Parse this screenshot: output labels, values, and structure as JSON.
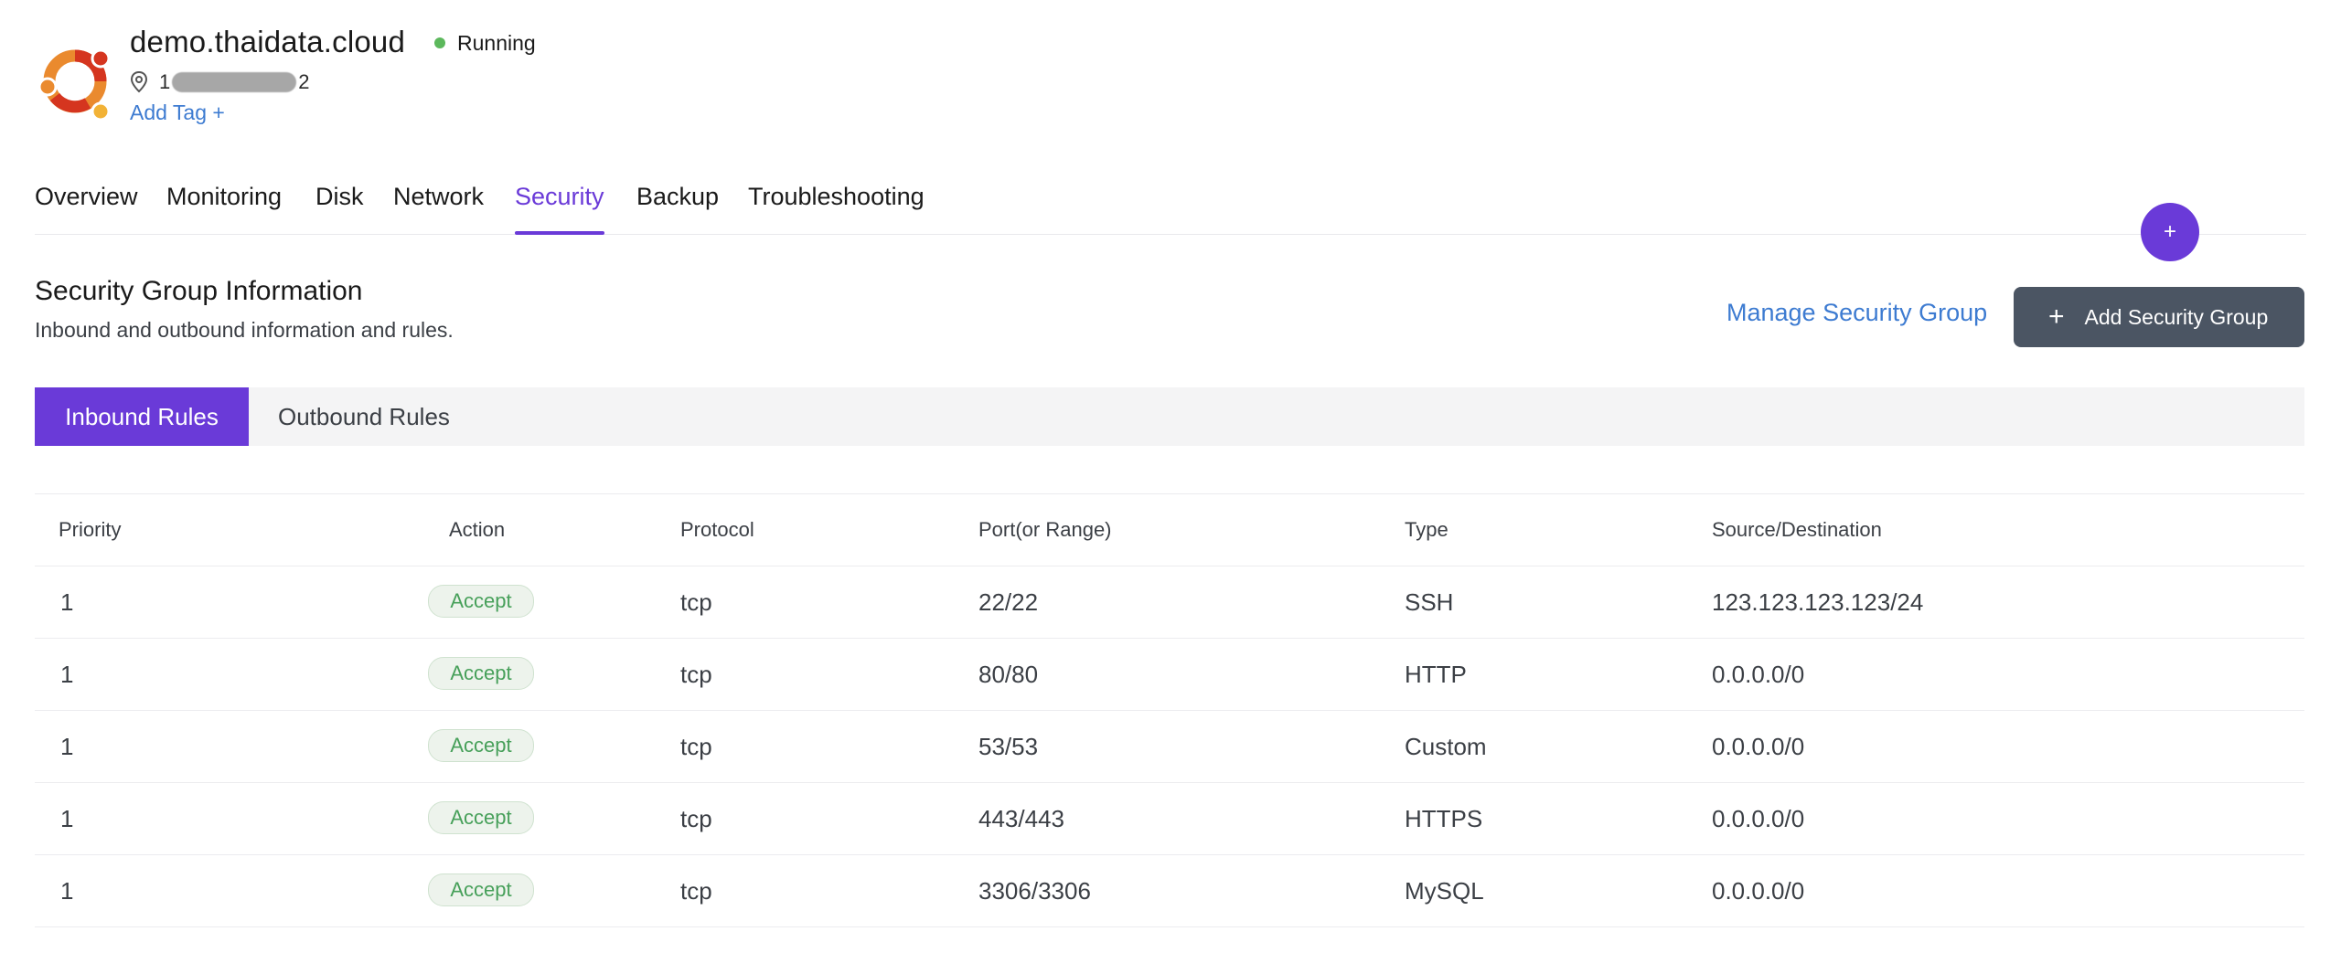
{
  "server": {
    "name": "demo.thaidata.cloud",
    "status": "Running",
    "status_color": "#5cb85c",
    "ip_prefix": "1",
    "ip_suffix": "2",
    "add_tag_label": "Add Tag +",
    "logo_icon": "ubuntu-logo",
    "location_icon": "map-pin-icon"
  },
  "tabs": [
    {
      "label": "Overview",
      "active": false
    },
    {
      "label": "Monitoring",
      "active": false
    },
    {
      "label": "Disk",
      "active": false
    },
    {
      "label": "Network",
      "active": false
    },
    {
      "label": "Security",
      "active": true
    },
    {
      "label": "Backup",
      "active": false
    },
    {
      "label": "Troubleshooting",
      "active": false
    }
  ],
  "fab": {
    "label": "+"
  },
  "section": {
    "title": "Security Group Information",
    "subtitle": "Inbound and outbound information and rules.",
    "manage_link": "Manage Security Group",
    "add_button": "Add Security Group",
    "add_button_icon": "+"
  },
  "rule_tabs": {
    "inbound": "Inbound Rules",
    "outbound": "Outbound Rules",
    "active": "inbound"
  },
  "table": {
    "headers": {
      "priority": "Priority",
      "action": "Action",
      "protocol": "Protocol",
      "port": "Port(or Range)",
      "type": "Type",
      "source": "Source/Destination"
    },
    "rows": [
      {
        "priority": "1",
        "action": "Accept",
        "protocol": "tcp",
        "port": "22/22",
        "type": "SSH",
        "source": "123.123.123.123/24"
      },
      {
        "priority": "1",
        "action": "Accept",
        "protocol": "tcp",
        "port": "80/80",
        "type": "HTTP",
        "source": "0.0.0.0/0"
      },
      {
        "priority": "1",
        "action": "Accept",
        "protocol": "tcp",
        "port": "53/53",
        "type": "Custom",
        "source": "0.0.0.0/0"
      },
      {
        "priority": "1",
        "action": "Accept",
        "protocol": "tcp",
        "port": "443/443",
        "type": "HTTPS",
        "source": "0.0.0.0/0"
      },
      {
        "priority": "1",
        "action": "Accept",
        "protocol": "tcp",
        "port": "3306/3306",
        "type": "MySQL",
        "source": "0.0.0.0/0"
      }
    ]
  },
  "colors": {
    "accent": "#6a3ad8",
    "link": "#3d7bd1",
    "button_dark": "#4b5563",
    "accept_text": "#47a05a",
    "accept_bg": "#edf3ec"
  }
}
